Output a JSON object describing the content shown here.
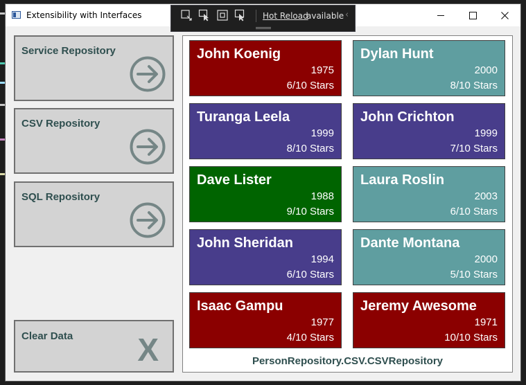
{
  "window": {
    "title": "Extensibility with Interfaces",
    "minimize_icon": "minimize-icon",
    "maximize_icon": "maximize-icon",
    "close_icon": "close-icon"
  },
  "hot_reload": {
    "link": "Hot Reload",
    "status": "available"
  },
  "sidebar": {
    "buttons": [
      {
        "label": "Service Repository",
        "icon": "arrow-right-circle-icon"
      },
      {
        "label": "CSV Repository",
        "icon": "arrow-right-circle-icon"
      },
      {
        "label": "SQL Repository",
        "icon": "arrow-right-circle-icon"
      },
      {
        "label": "Clear Data",
        "icon": "X"
      }
    ]
  },
  "people": [
    {
      "name": "John Koenig",
      "year": "1975",
      "rating": "6/10 Stars",
      "color": "#8b0000"
    },
    {
      "name": "Dylan Hunt",
      "year": "2000",
      "rating": "8/10 Stars",
      "color": "#5f9ea0"
    },
    {
      "name": "Turanga Leela",
      "year": "1999",
      "rating": "8/10 Stars",
      "color": "#483d8b"
    },
    {
      "name": "John Crichton",
      "year": "1999",
      "rating": "7/10 Stars",
      "color": "#483d8b"
    },
    {
      "name": "Dave Lister",
      "year": "1988",
      "rating": "9/10 Stars",
      "color": "#006400"
    },
    {
      "name": "Laura Roslin",
      "year": "2003",
      "rating": "6/10 Stars",
      "color": "#5f9ea0"
    },
    {
      "name": "John Sheridan",
      "year": "1994",
      "rating": "6/10 Stars",
      "color": "#483d8b"
    },
    {
      "name": "Dante Montana",
      "year": "2000",
      "rating": "5/10 Stars",
      "color": "#5f9ea0"
    },
    {
      "name": "Isaac Gampu",
      "year": "1977",
      "rating": "4/10 Stars",
      "color": "#8b0000"
    },
    {
      "name": "Jeremy Awesome",
      "year": "1971",
      "rating": "10/10 Stars",
      "color": "#8b0000"
    }
  ],
  "repository_type": "PersonRepository.CSV.CSVRepository",
  "colors": {
    "button_text": "#2f4f4f",
    "button_bg": "#d3d3d3",
    "icon_gray": "#758686"
  }
}
